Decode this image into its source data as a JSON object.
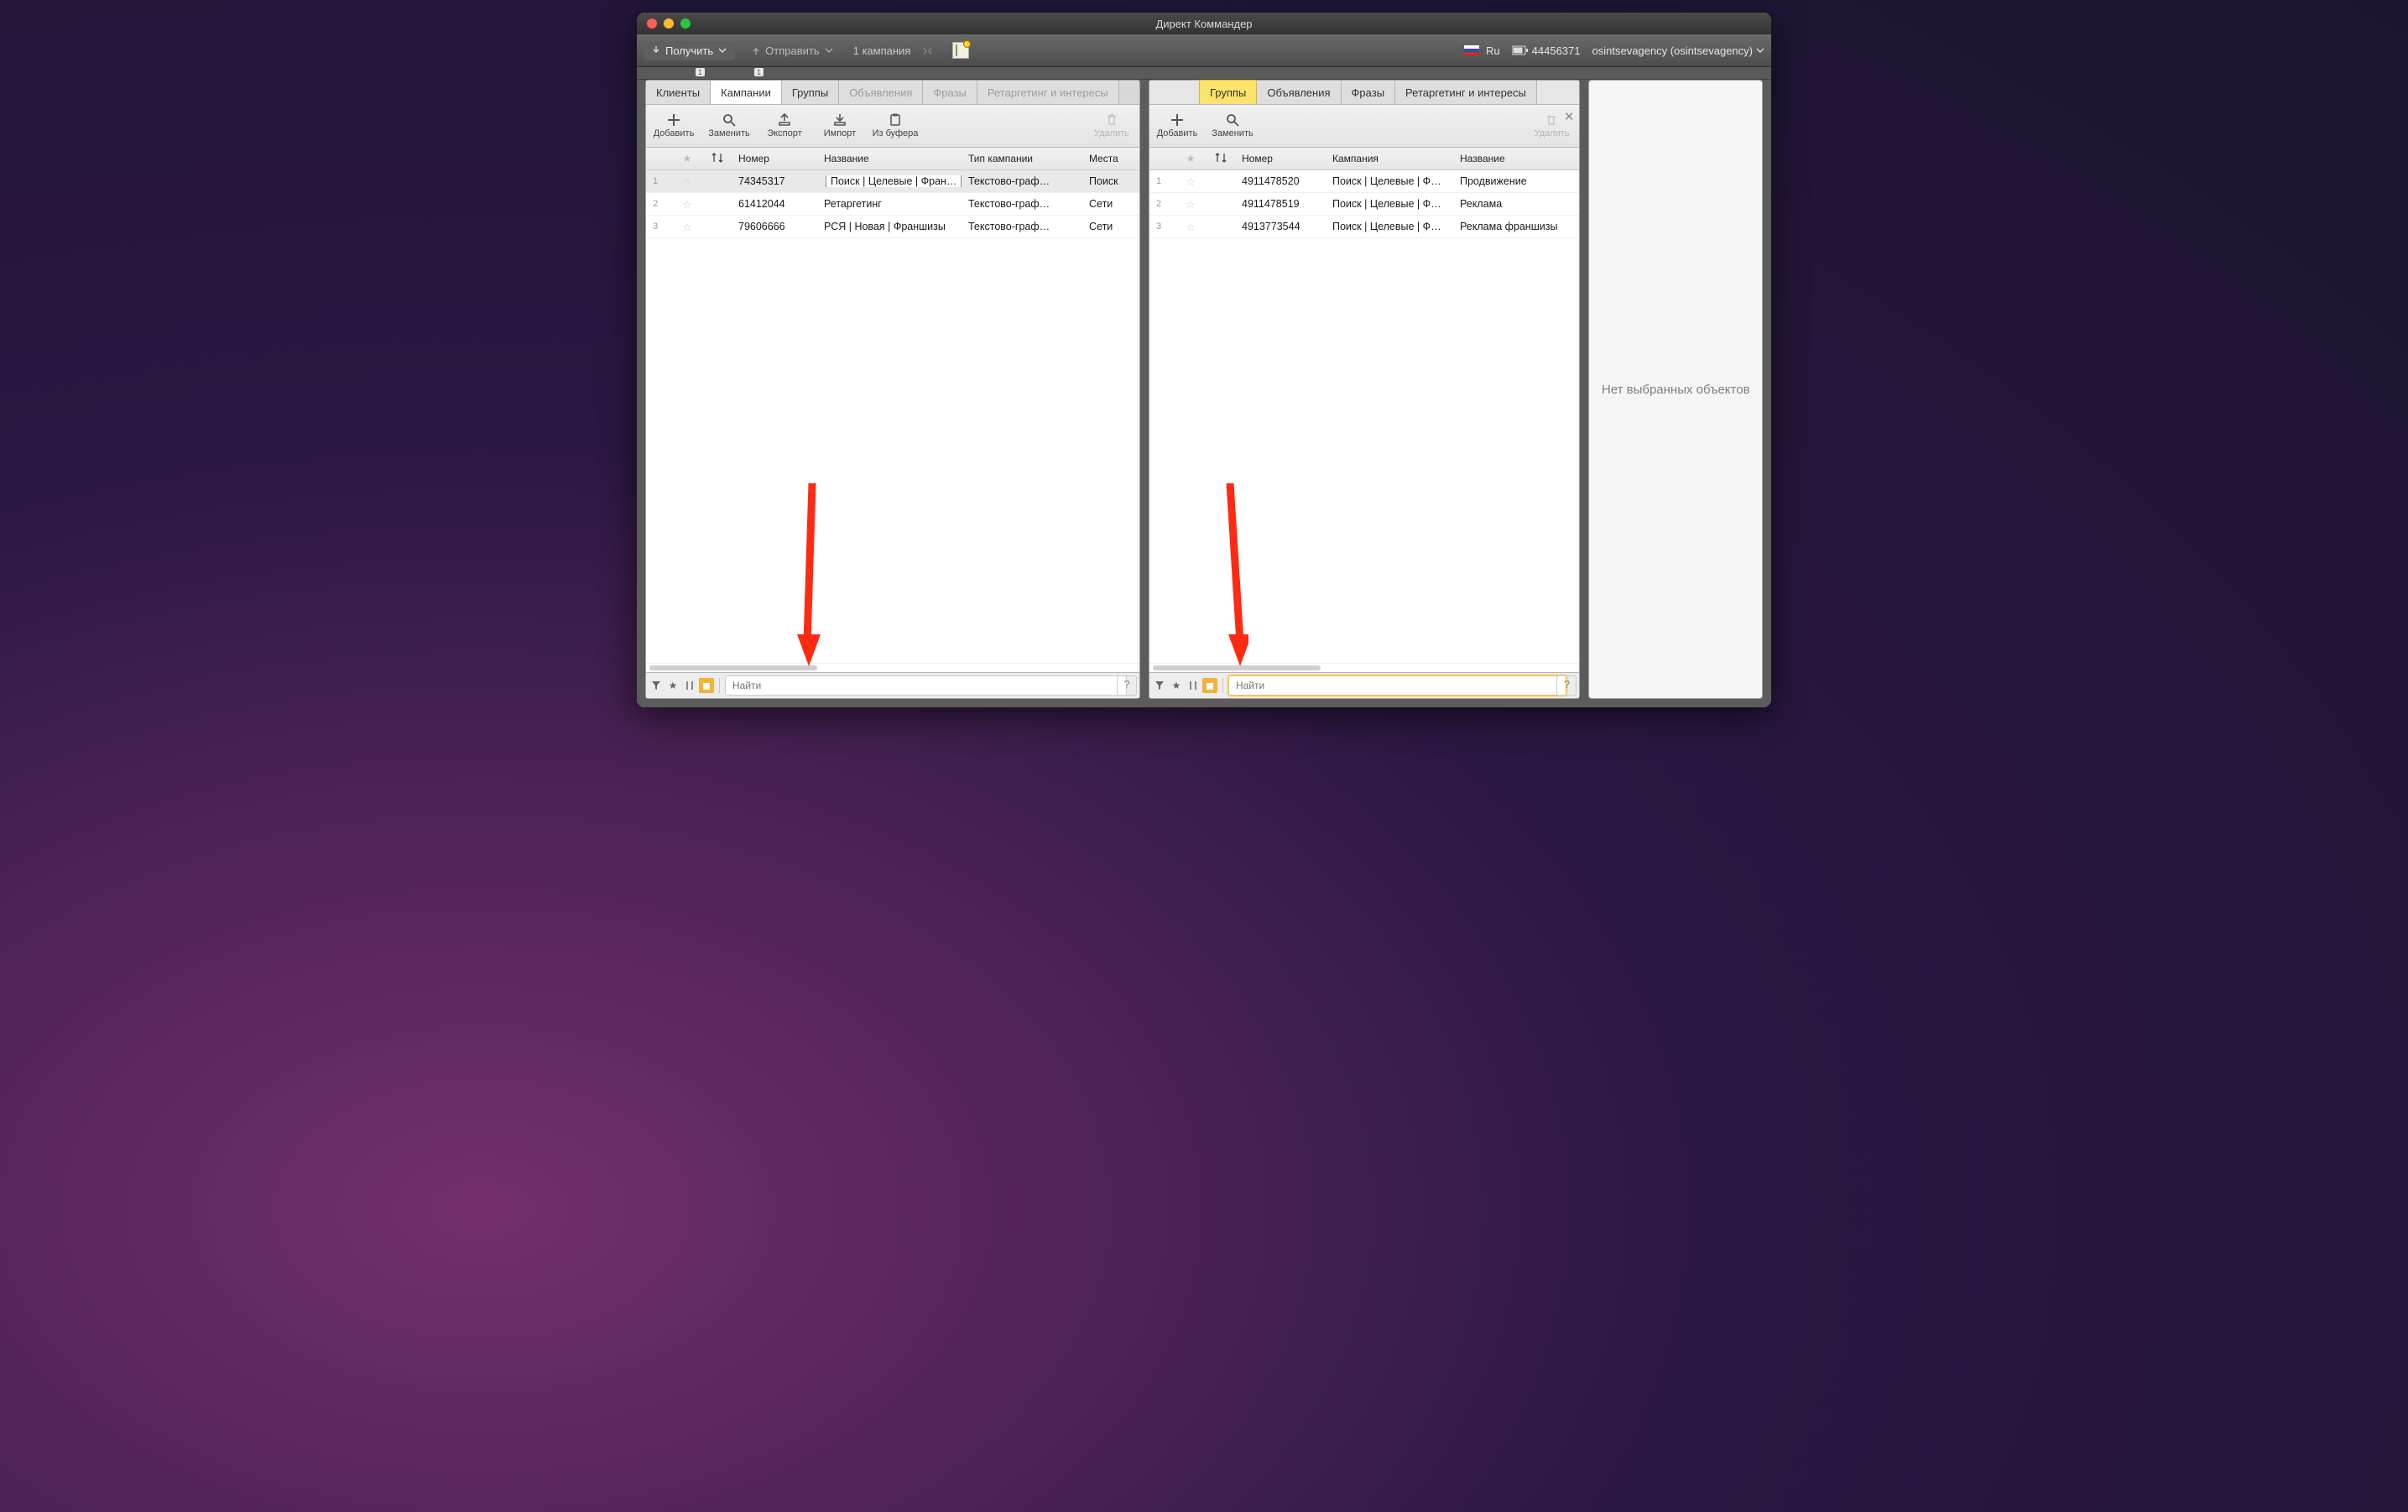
{
  "app_title": "Директ Коммандер",
  "header": {
    "receive": "Получить",
    "send": "Отправить",
    "campaign_count": "1 кампания",
    "lang": "Ru",
    "account_num": "44456371",
    "user_label": "osintsevagency (osintsevagency)"
  },
  "badges": {
    "b1": "1",
    "b2": "1"
  },
  "left_panel": {
    "tabs": [
      "Клиенты",
      "Кампании",
      "Группы",
      "Объявления",
      "Фразы",
      "Ретаргетинг и интересы"
    ],
    "actions": {
      "add": "Добавить",
      "replace": "Заменить",
      "export": "Экспорт",
      "import": "Импорт",
      "buffer": "Из буфера",
      "delete": "Удалить"
    },
    "columns": {
      "num": "Номер",
      "name": "Название",
      "type": "Тип кампании",
      "place": "Места"
    },
    "rows": [
      {
        "idx": "1",
        "num": "74345317",
        "name": "Поиск | Целевые | Фран…",
        "type": "Текстово-граф…",
        "place": "Поиск",
        "sel": true
      },
      {
        "idx": "2",
        "num": "61412044",
        "name": "Ретаргетинг",
        "type": "Текстово-граф…",
        "place": "Сети",
        "sel": false
      },
      {
        "idx": "3",
        "num": "79606666",
        "name": "РСЯ | Новая | Франшизы",
        "type": "Текстово-граф…",
        "place": "Сети",
        "sel": false
      }
    ],
    "search_placeholder": "Найти"
  },
  "mid_panel": {
    "tabs": [
      "Группы",
      "Объявления",
      "Фразы",
      "Ретаргетинг и интересы"
    ],
    "actions": {
      "add": "Добавить",
      "replace": "Заменить",
      "delete": "Удалить"
    },
    "columns": {
      "num": "Номер",
      "camp": "Кампания",
      "name": "Название"
    },
    "rows": [
      {
        "idx": "1",
        "num": "4911478520",
        "camp": "Поиск | Целевые | Ф…",
        "name": "Продвижение"
      },
      {
        "idx": "2",
        "num": "4911478519",
        "camp": "Поиск | Целевые | Ф…",
        "name": "Реклама"
      },
      {
        "idx": "3",
        "num": "4913773544",
        "camp": "Поиск | Целевые | Ф…",
        "name": "Реклама франшизы"
      }
    ],
    "search_placeholder": "Найти"
  },
  "right_panel": {
    "empty_text": "Нет выбранных объектов"
  }
}
